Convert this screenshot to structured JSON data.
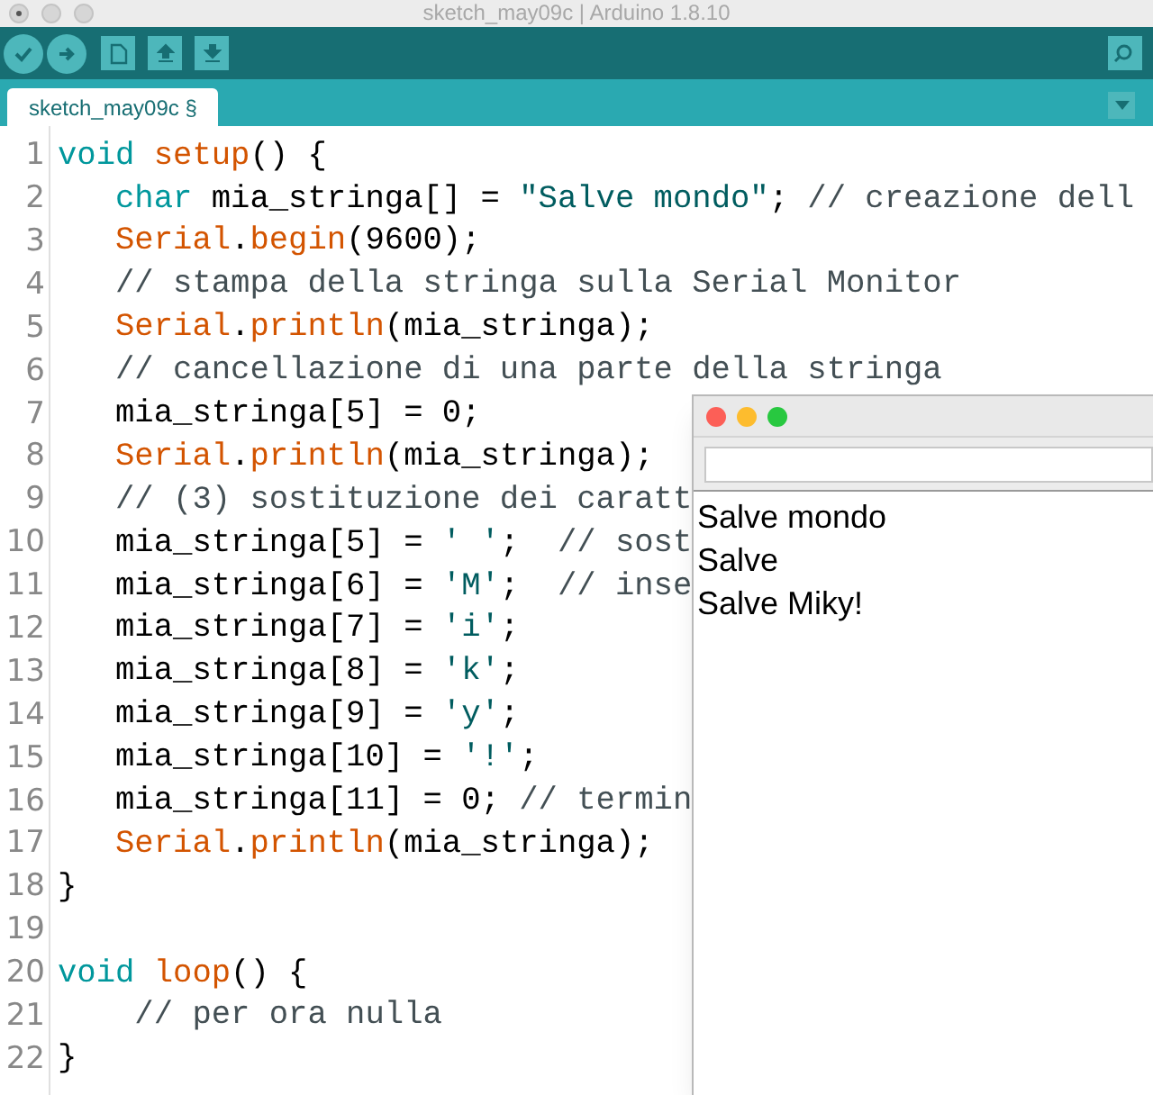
{
  "window": {
    "title": "sketch_may09c | Arduino 1.8.10"
  },
  "tabs": [
    {
      "label": "sketch_may09c §",
      "selected": true
    }
  ],
  "editor": {
    "lines": [
      {
        "number": "1",
        "tokens": [
          {
            "kind": "keyword",
            "text": "void "
          },
          {
            "kind": "function",
            "text": "setup"
          },
          {
            "kind": "plain",
            "text": "() {"
          }
        ]
      },
      {
        "number": "2",
        "tokens": [
          {
            "kind": "keyword",
            "text": "   char"
          },
          {
            "kind": "plain",
            "text": " mia_stringa[] = "
          },
          {
            "kind": "string",
            "text": "\"Salve mondo\""
          },
          {
            "kind": "plain",
            "text": "; "
          },
          {
            "kind": "comment",
            "text": "// creazione dell"
          }
        ]
      },
      {
        "number": "3",
        "tokens": [
          {
            "kind": "function",
            "text": "   Serial"
          },
          {
            "kind": "plain",
            "text": "."
          },
          {
            "kind": "function",
            "text": "begin"
          },
          {
            "kind": "plain",
            "text": "(9600);"
          }
        ]
      },
      {
        "number": "4",
        "tokens": [
          {
            "kind": "comment",
            "text": "   // stampa della stringa sulla Serial Monitor"
          }
        ]
      },
      {
        "number": "5",
        "tokens": [
          {
            "kind": "function",
            "text": "   Serial"
          },
          {
            "kind": "plain",
            "text": "."
          },
          {
            "kind": "function",
            "text": "println"
          },
          {
            "kind": "plain",
            "text": "(mia_stringa);"
          }
        ]
      },
      {
        "number": "6",
        "tokens": [
          {
            "kind": "comment",
            "text": "   // cancellazione di una parte della stringa"
          }
        ]
      },
      {
        "number": "7",
        "tokens": [
          {
            "kind": "plain",
            "text": "   mia_stringa[5] = 0;"
          }
        ]
      },
      {
        "number": "8",
        "tokens": [
          {
            "kind": "function",
            "text": "   Serial"
          },
          {
            "kind": "plain",
            "text": "."
          },
          {
            "kind": "function",
            "text": "println"
          },
          {
            "kind": "plain",
            "text": "(mia_stringa);"
          }
        ]
      },
      {
        "number": "9",
        "tokens": [
          {
            "kind": "comment",
            "text": "   // (3) sostituzione dei caratt"
          }
        ]
      },
      {
        "number": "10",
        "tokens": [
          {
            "kind": "plain",
            "text": "   mia_stringa[5] = "
          },
          {
            "kind": "string",
            "text": "' '"
          },
          {
            "kind": "plain",
            "text": ";  "
          },
          {
            "kind": "comment",
            "text": "// sost"
          }
        ]
      },
      {
        "number": "11",
        "tokens": [
          {
            "kind": "plain",
            "text": "   mia_stringa[6] = "
          },
          {
            "kind": "string",
            "text": "'M'"
          },
          {
            "kind": "plain",
            "text": ";  "
          },
          {
            "kind": "comment",
            "text": "// inse"
          }
        ]
      },
      {
        "number": "12",
        "tokens": [
          {
            "kind": "plain",
            "text": "   mia_stringa[7] = "
          },
          {
            "kind": "string",
            "text": "'i'"
          },
          {
            "kind": "plain",
            "text": ";"
          }
        ]
      },
      {
        "number": "13",
        "tokens": [
          {
            "kind": "plain",
            "text": "   mia_stringa[8] = "
          },
          {
            "kind": "string",
            "text": "'k'"
          },
          {
            "kind": "plain",
            "text": ";"
          }
        ]
      },
      {
        "number": "14",
        "tokens": [
          {
            "kind": "plain",
            "text": "   mia_stringa[9] = "
          },
          {
            "kind": "string",
            "text": "'y'"
          },
          {
            "kind": "plain",
            "text": ";"
          }
        ]
      },
      {
        "number": "15",
        "tokens": [
          {
            "kind": "plain",
            "text": "   mia_stringa[10] = "
          },
          {
            "kind": "string",
            "text": "'!'"
          },
          {
            "kind": "plain",
            "text": ";"
          }
        ]
      },
      {
        "number": "16",
        "tokens": [
          {
            "kind": "plain",
            "text": "   mia_stringa[11] = 0; "
          },
          {
            "kind": "comment",
            "text": "// termin"
          }
        ]
      },
      {
        "number": "17",
        "tokens": [
          {
            "kind": "function",
            "text": "   Serial"
          },
          {
            "kind": "plain",
            "text": "."
          },
          {
            "kind": "function",
            "text": "println"
          },
          {
            "kind": "plain",
            "text": "(mia_stringa);"
          }
        ]
      },
      {
        "number": "18",
        "tokens": [
          {
            "kind": "plain",
            "text": "}"
          }
        ]
      },
      {
        "number": "19"
      },
      {
        "number": "20",
        "tokens": [
          {
            "kind": "keyword",
            "text": "void "
          },
          {
            "kind": "function",
            "text": "loop"
          },
          {
            "kind": "plain",
            "text": "() {"
          }
        ]
      },
      {
        "number": "21",
        "tokens": [
          {
            "kind": "comment",
            "text": "    // per ora nulla"
          }
        ]
      },
      {
        "number": "22",
        "tokens": [
          {
            "kind": "plain",
            "text": "}"
          }
        ]
      }
    ]
  },
  "serial_monitor": {
    "output": [
      "Salve mondo",
      "Salve",
      "Salve Miky!"
    ]
  }
}
